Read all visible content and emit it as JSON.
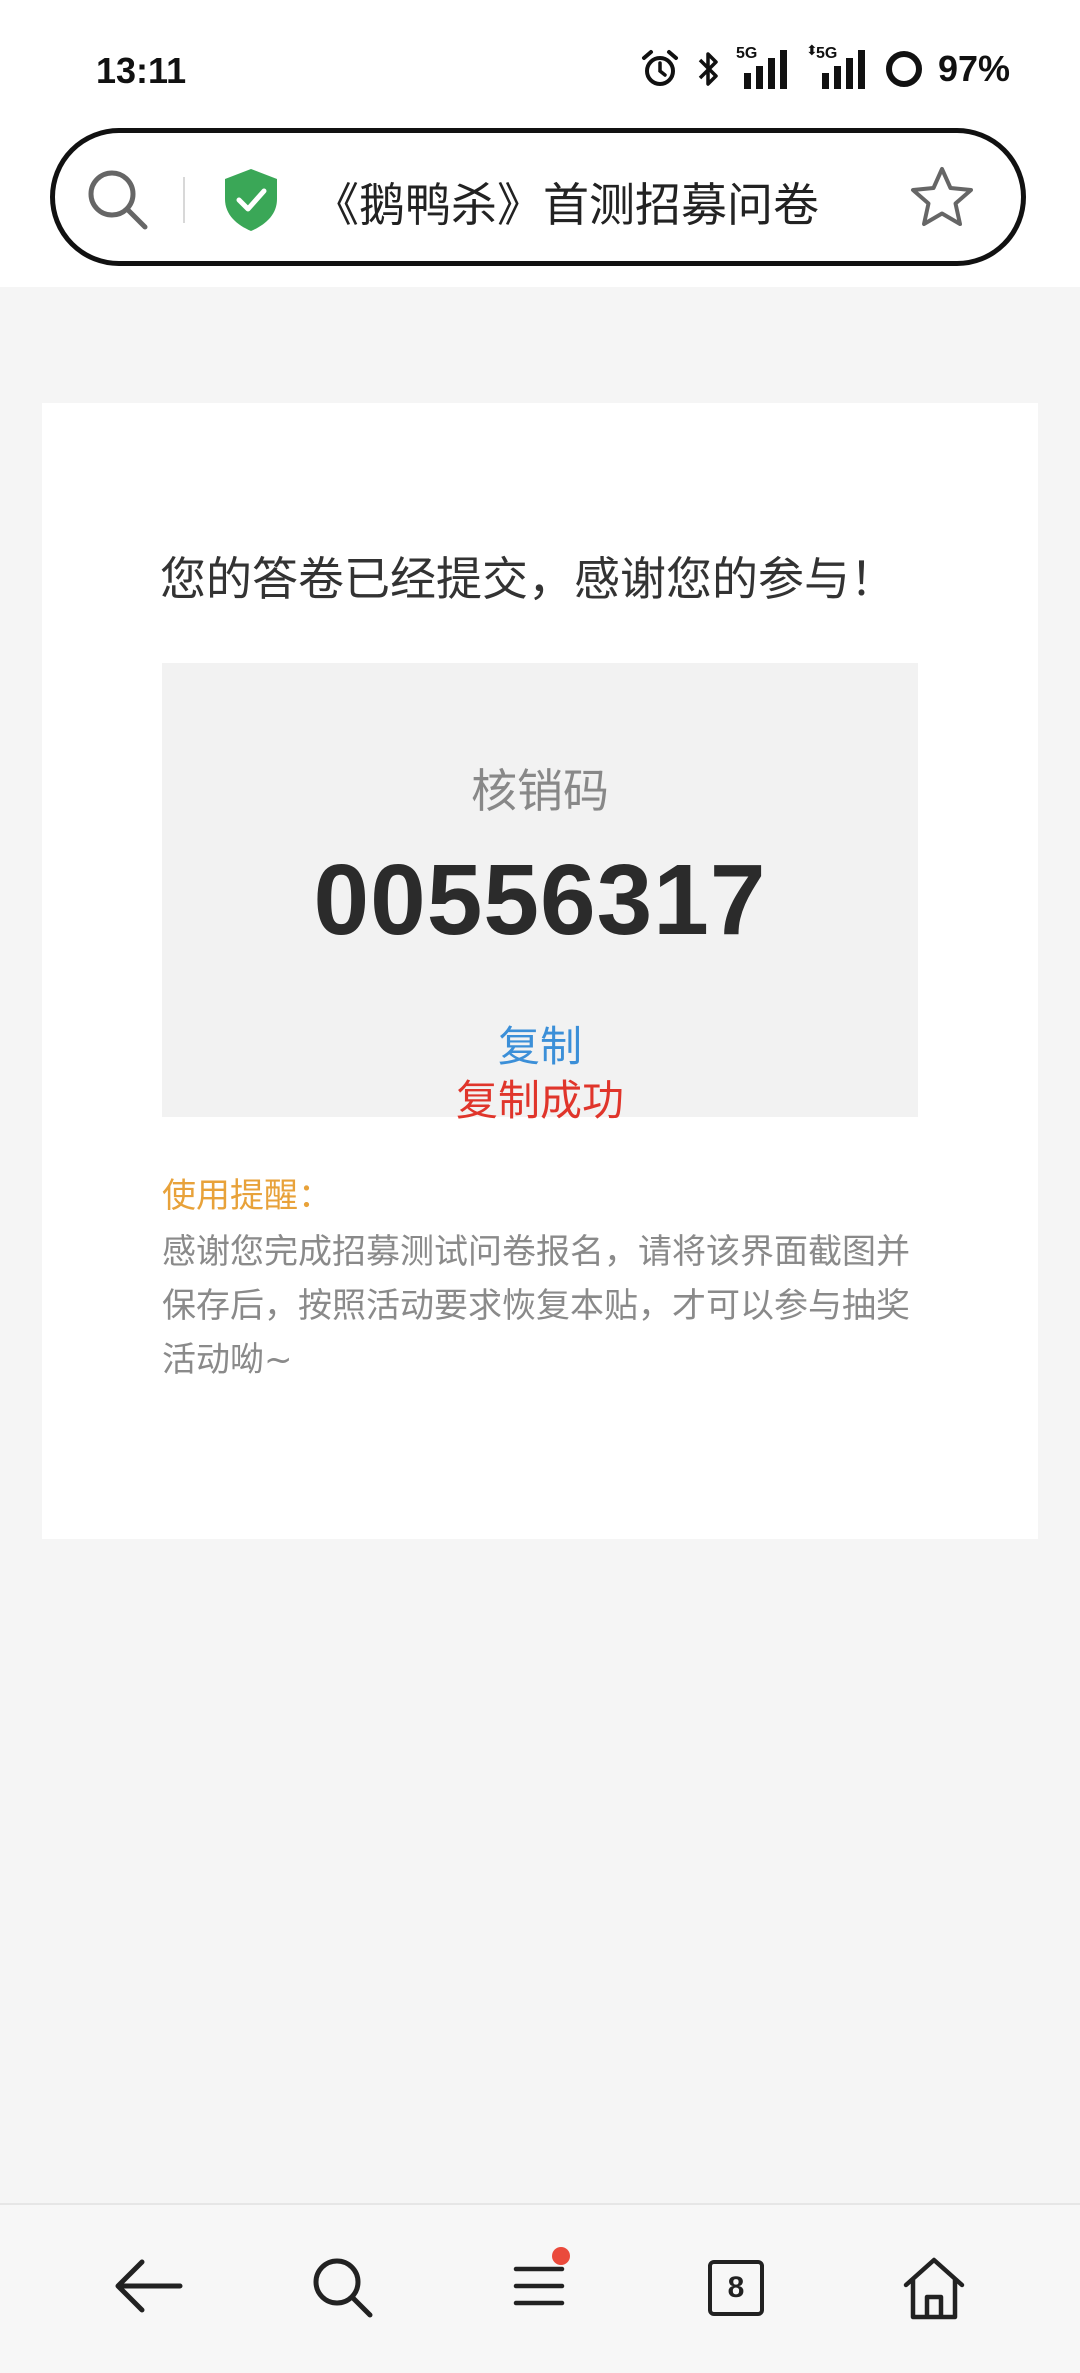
{
  "status_bar": {
    "time": "13:11",
    "battery": "97%",
    "network_1": "5G",
    "network_2": "5G"
  },
  "address_bar": {
    "title": "《鹅鸭杀》首测招募问卷",
    "icons": [
      "search-icon",
      "secure-shield-icon",
      "star-icon"
    ]
  },
  "card": {
    "message": "您的答卷已经提交，感谢您的参与！",
    "code_label": "核销码",
    "code_value": "00556317",
    "copy_label": "复制",
    "copy_success": "复制成功",
    "reminder_title": "使用提醒：",
    "reminder_text": "感谢您完成招募测试问卷报名，请将该界面截图并保存后，按照活动要求恢复本贴，才可以参与抽奖活动呦~"
  },
  "bottom_nav": {
    "items": [
      "back-icon",
      "search-icon",
      "menu-icon",
      "tabs-icon",
      "home-icon"
    ],
    "tab_count": "8"
  },
  "colors": {
    "accent_blue": "#3b8fd8",
    "success_red": "#e0352b",
    "reminder_orange": "#e8a23a",
    "shield_green": "#3aa757"
  }
}
